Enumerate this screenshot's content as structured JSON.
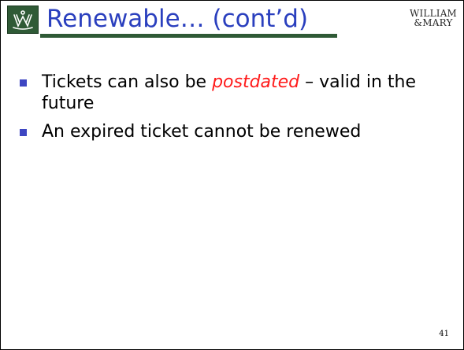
{
  "header": {
    "title": "Renewable… (cont’d)",
    "logo_icon": "crest-icon",
    "wordmark_line1": "WILLIAM",
    "wordmark_line2": "&MARY",
    "accent_color": "#2f5a36",
    "title_color": "#2a3fbe"
  },
  "bullets": [
    {
      "lead": "Tickets can also be ",
      "emphasis": "postdated",
      "tail": " – valid in the future"
    },
    {
      "text": "An expired ticket cannot be renewed"
    }
  ],
  "colors": {
    "bullet_marker": "#3d46c2",
    "emphasis": "#ff1a1a"
  },
  "footer": {
    "page_number": "41"
  }
}
